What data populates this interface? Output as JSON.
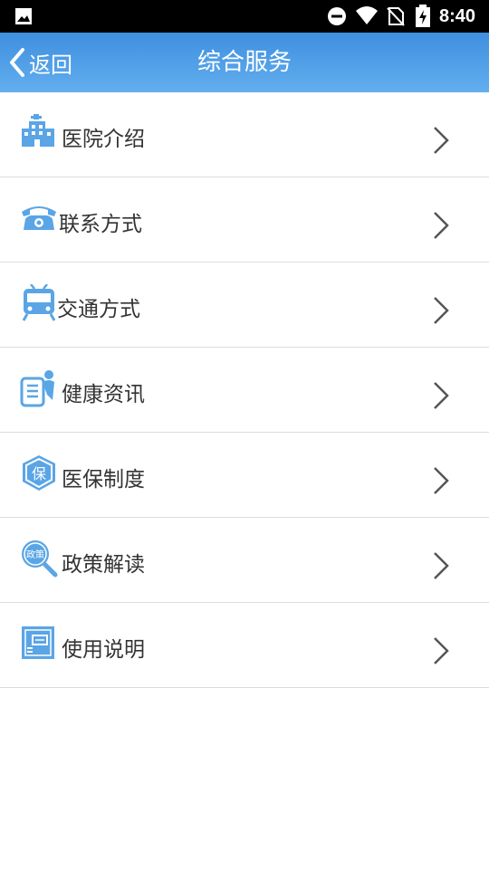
{
  "status_bar": {
    "time": "8:40",
    "icons": [
      "image-icon",
      "do-not-disturb-icon",
      "wifi-icon",
      "no-sim-icon",
      "battery-charging-icon"
    ]
  },
  "header": {
    "back_label": "返回",
    "title": "综合服务",
    "colors": {
      "gradient_top": "#3f8fe0",
      "gradient_bottom": "#62aeee"
    }
  },
  "menu": {
    "items": [
      {
        "label": "医院介绍",
        "icon": "hospital-icon"
      },
      {
        "label": "联系方式",
        "icon": "telephone-icon"
      },
      {
        "label": "交通方式",
        "icon": "train-icon"
      },
      {
        "label": "健康资讯",
        "icon": "health-news-icon"
      },
      {
        "label": "医保制度",
        "icon": "insurance-shield-icon"
      },
      {
        "label": "政策解读",
        "icon": "policy-magnifier-icon"
      },
      {
        "label": "使用说明",
        "icon": "manual-book-icon"
      }
    ],
    "icon_color": "#5aa5e6",
    "chevron_color": "#555555"
  }
}
